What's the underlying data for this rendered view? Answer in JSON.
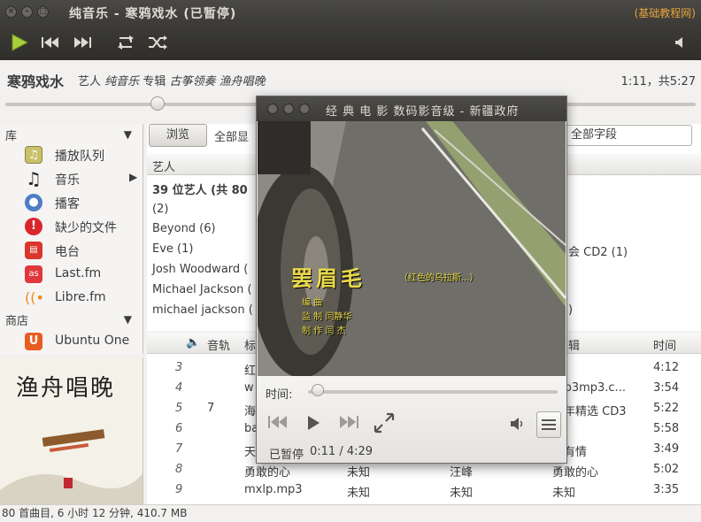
{
  "window": {
    "title": "纯音乐 - 寒鸦戏水 (已暂停)",
    "corner_label": "(基础教程网)"
  },
  "toolbar": {
    "play_icon": "play-icon",
    "prev_icon": "previous-icon",
    "next_icon": "next-icon",
    "repeat_icon": "repeat-icon",
    "shuffle_icon": "shuffle-icon",
    "volume_icon": "volume-icon"
  },
  "now_playing": {
    "title": "寒鸦戏水",
    "by_label": "艺人",
    "artist": "纯音乐",
    "album_label": "专辑",
    "album": "古筝领奏 渔舟唱晚",
    "time": "1:11，共5:27",
    "progress_fraction": 0.22
  },
  "sidebar": {
    "library_header": "库",
    "store_header": "商店",
    "items": [
      {
        "label": "播放队列",
        "icon": "queue-icon"
      },
      {
        "label": "音乐",
        "icon": "music-note-icon"
      },
      {
        "label": "播客",
        "icon": "podcast-icon"
      },
      {
        "label": "缺少的文件",
        "icon": "missing-files-icon"
      },
      {
        "label": "电台",
        "icon": "radio-icon"
      },
      {
        "label": "Last.fm",
        "icon": "lastfm-icon"
      },
      {
        "label": "Libre.fm",
        "icon": "librefm-icon"
      }
    ],
    "store_items": [
      {
        "label": "Ubuntu One",
        "icon": "ubuntu-one-icon"
      }
    ]
  },
  "album_art": {
    "title_text": "渔舟唱晚"
  },
  "browser": {
    "browse_button": "浏览",
    "scope_text": "全部显",
    "search_placeholder": "全部字段",
    "artist_column": "艺人",
    "artists": [
      "39 位艺人 (共 80",
      "(2)",
      "Beyond (6)",
      "Eve (1)",
      "Josh Woodward (",
      "Michael Jackson (",
      "michael jackson ("
    ],
    "album_fragments": [
      "会 CD2 (1)",
      ")"
    ]
  },
  "tracklist": {
    "columns": {
      "track": "音轨",
      "title": "标",
      "album": "辑",
      "time": "时间"
    },
    "rows": [
      {
        "num": "3",
        "track": "",
        "title": "红",
        "artist": "",
        "genre": "",
        "album": "知",
        "time": "4:12"
      },
      {
        "num": "4",
        "track": "",
        "title": "w",
        "artist": "",
        "genre": "",
        "album": "w.p3mp3.c...",
        "time": "3:54"
      },
      {
        "num": "5",
        "track": "7",
        "title": "海",
        "artist": "",
        "genre": "",
        "album": "周年精选 CD3",
        "time": "5:22"
      },
      {
        "num": "6",
        "track": "",
        "title": "ba",
        "artist": "",
        "genre": "",
        "album": "知",
        "time": "5:58"
      },
      {
        "num": "7",
        "track": "",
        "title": "天已暂停",
        "artist": "",
        "genre": "",
        "album": "吾有情",
        "time": "3:49"
      },
      {
        "num": "8",
        "track": "",
        "title": "勇敢的心",
        "artist": "未知",
        "genre": "汪峰",
        "album": "勇敢的心",
        "time": "5:02"
      },
      {
        "num": "9",
        "track": "",
        "title": "mxlp.mp3",
        "artist": "未知",
        "genre": "未知",
        "album": "未知",
        "time": "3:35"
      }
    ]
  },
  "status": {
    "text": "80 首曲目, 6 小时 12 分钟, 410.7 MB"
  },
  "video_window": {
    "title": "经 典 电 影  数码影音级 - 新疆政府",
    "subtitle_big": "罢眉毛",
    "subtitle_small": "（红色的乌拉斯...）",
    "credits": [
      "编    曲",
      "监    制     闫静华",
      "制    作     闫    杰"
    ],
    "time_label": "时间:",
    "status_text": "已暂停",
    "time_readout": "0:11 / 4:29",
    "progress_fraction": 0.04
  }
}
